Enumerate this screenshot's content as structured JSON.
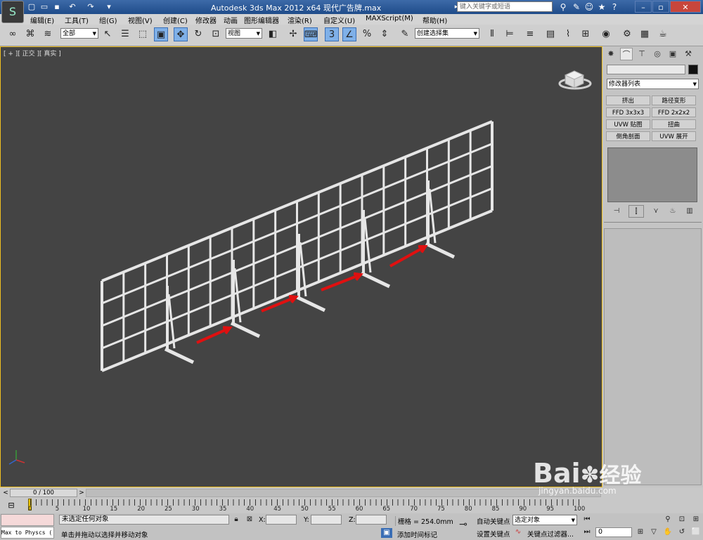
{
  "title_bar": {
    "title": "Autodesk 3ds Max  2012 x64    现代广告牌.max",
    "search_placeholder": "键入关键字或短语",
    "quick_access_icons": [
      "new-icon",
      "open-icon",
      "save-icon",
      "undo-icon",
      "redo-icon",
      "dropdown-icon"
    ],
    "app_logo": "3ds-max-logo"
  },
  "menu": [
    "编辑(E)",
    "工具(T)",
    "组(G)",
    "视图(V)",
    "创建(C)",
    "修改器",
    "动画",
    "图形编辑器",
    "渲染(R)",
    "自定义(U)",
    "MAXScript(M)",
    "帮助(H)"
  ],
  "toolbar": {
    "selection_filter": "全部",
    "reference_coord": "视图",
    "named_selection": "创建选择集"
  },
  "viewport": {
    "label": "[ + ][ 正交 ][ 真实 ]",
    "background": "#444444",
    "border_color": "#f0c020",
    "model_color": "#e6e6e6",
    "arrow_color": "#e01010"
  },
  "command_panel": {
    "modifier_list": "修改器列表",
    "buttons": [
      "挤出",
      "路径变形",
      "FFD 3x3x3",
      "FFD 2x2x2",
      "UVW 贴图",
      "扭曲",
      "倒角剖面",
      "UVW 展开"
    ]
  },
  "timeline": {
    "frame_display": "0 / 100",
    "ticks": [
      "0",
      "5",
      "10",
      "15",
      "20",
      "25",
      "30",
      "35",
      "40",
      "45",
      "50",
      "55",
      "60",
      "65",
      "70",
      "75",
      "80",
      "85",
      "90",
      "95",
      "100"
    ]
  },
  "status": {
    "script_listener": "Max to Physcs (",
    "selection_status": "未选定任何对象",
    "prompt": "单击并拖动以选择并移动对象",
    "x_label": "X:",
    "y_label": "Y:",
    "z_label": "Z:",
    "grid": "栅格 = 254.0mm",
    "add_time_tag": "添加时间标记",
    "auto_key": "自动关键点",
    "set_key": "设置关键点",
    "selected_object": "选定对象",
    "key_filters": "关键点过滤器...",
    "frame_value": "0"
  },
  "watermark": {
    "brand": "Bai",
    "brand2": "经验",
    "url": "jingyan.baidu.com"
  }
}
